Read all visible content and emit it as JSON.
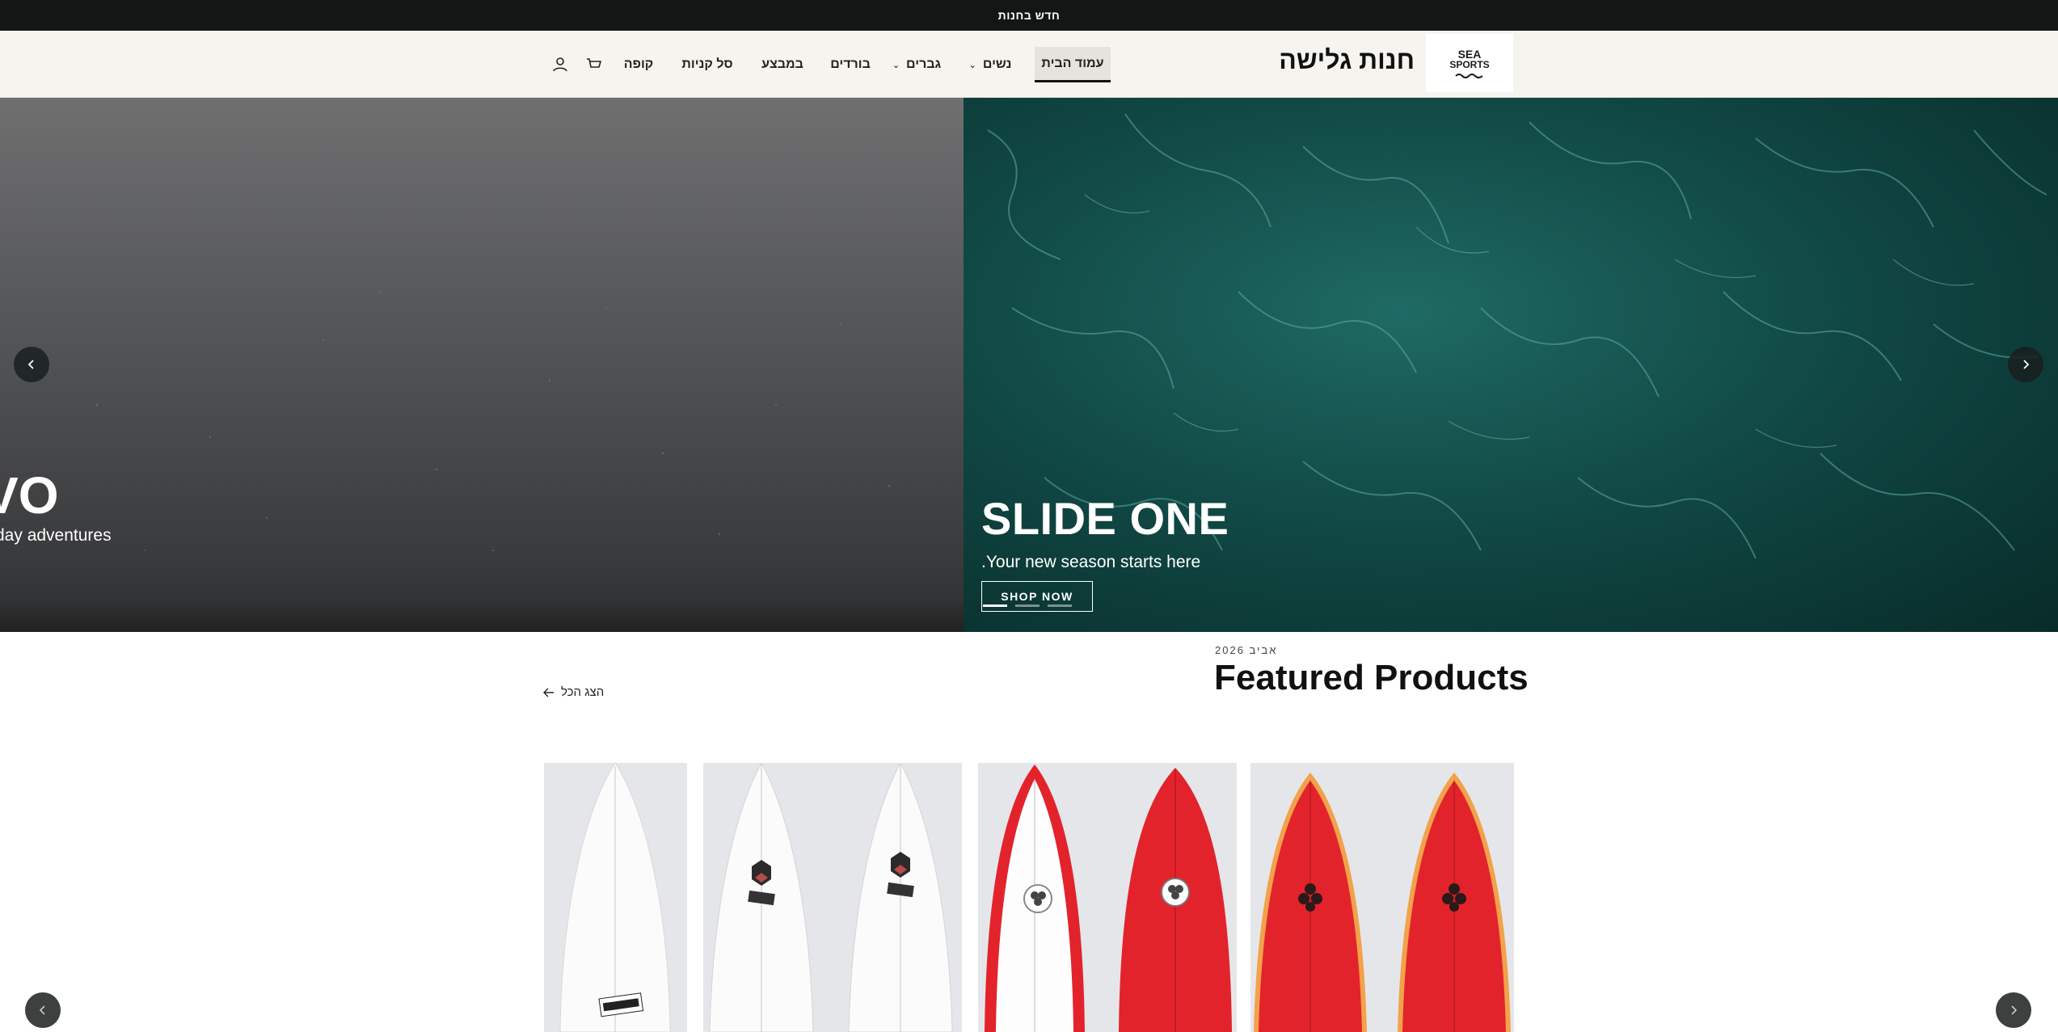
{
  "announcement": {
    "text": "חדש בחנות"
  },
  "header": {
    "logo": {
      "line1": "SEA",
      "line2": "SPORTS"
    },
    "shop_name": "חנות גלישה",
    "nav": [
      {
        "label": "עמוד הבית",
        "active": true
      },
      {
        "label": "נשים",
        "has_dropdown": true
      },
      {
        "label": "גברים",
        "has_dropdown": true
      },
      {
        "label": "בורדים"
      },
      {
        "label": "במבצע"
      },
      {
        "label": "סל קניות"
      },
      {
        "label": "קופה"
      }
    ],
    "icons": [
      "cart-icon",
      "account-icon"
    ]
  },
  "hero": {
    "slide_one": {
      "title": "SLIDE ONE",
      "subtitle": ".Your new season starts here",
      "button": "SHOP NOW"
    },
    "slide_two": {
      "title_partial": "VO",
      "subtitle_partial": "day adventures"
    },
    "indicators": 3,
    "active_indicator": 1
  },
  "featured": {
    "season": "אביב 2026",
    "title": "Featured Products",
    "view_all": "הצג הכל"
  },
  "colors": {
    "announcement_bg": "#121716",
    "header_bg": "#f5f4ef",
    "hero_teal": "#114a46",
    "hero_gray": "#5c5d5f",
    "board_red": "#e3232b",
    "board_rail_orange": "#f2a24a",
    "card_bg": "#e5e6ea"
  }
}
